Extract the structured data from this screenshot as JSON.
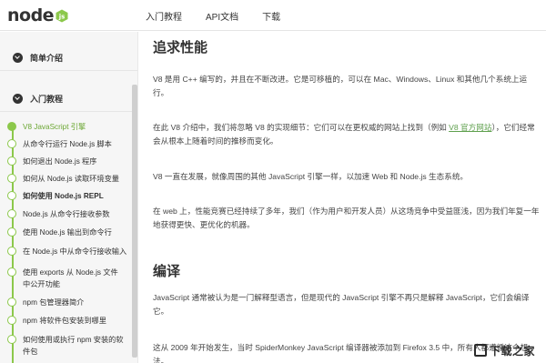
{
  "header": {
    "logo_text": "node",
    "nav": [
      "入门教程",
      "API文档",
      "下载"
    ]
  },
  "sidebar": {
    "sections": [
      "简单介绍",
      "入门教程"
    ],
    "toc": [
      {
        "label": "V8 JavaScript 引擎",
        "active": true
      },
      {
        "label": "从命令行运行 Node.js 脚本"
      },
      {
        "label": "如何退出 Node.js 程序"
      },
      {
        "label": "如何从 Node.js 读取环境变量"
      },
      {
        "label": "如何使用 Node.js REPL"
      },
      {
        "label": "Node.js 从命令行接收参数"
      },
      {
        "label": "使用 Node.js 输出到命令行"
      },
      {
        "label": "在 Node.js 中从命令行接收输入"
      },
      {
        "label": "使用 exports 从 Node.js 文件中公开功能"
      },
      {
        "label": "npm 包管理器简介"
      },
      {
        "label": "npm 将软件包安装到哪里"
      },
      {
        "label": "如何使用或执行 npm 安装的软件包"
      }
    ]
  },
  "main": {
    "h_perf": "追求性能",
    "p1": "V8 是用 C++ 编写的，并且在不断改进。它是可移植的，可以在 Mac、Windows、Linux 和其他几个系统上运行。",
    "p2_before": "在此 V8 介绍中，我们将忽略 V8 的实现细节：它们可以在更权威的网站上找到（例如 ",
    "p2_link": "V8 官方网站",
    "p2_after": "），它们经常会从根本上随着时间的推移而变化。",
    "p3": "V8 一直在发展，就像周围的其他 JavaScript 引擎一样，以加速 Web 和 Node.js 生态系统。",
    "p4": "在 web 上，性能竞赛已经持续了多年，我们（作为用户和开发人员）从这场竞争中受益匪浅，因为我们年复一年地获得更快、更优化的机器。",
    "h_compile": "编译",
    "p5": "JavaScript 通常被认为是一门解释型语言，但是现代的 JavaScript 引擎不再只是解释 JavaScript，它们会编译它。",
    "p6": "这从 2009 年开始发生，当时 SpiderMonkey JavaScript 编译器被添加到 Firefox 3.5 中，所有人都遵循这个想法。"
  },
  "watermark": "下载之家"
}
